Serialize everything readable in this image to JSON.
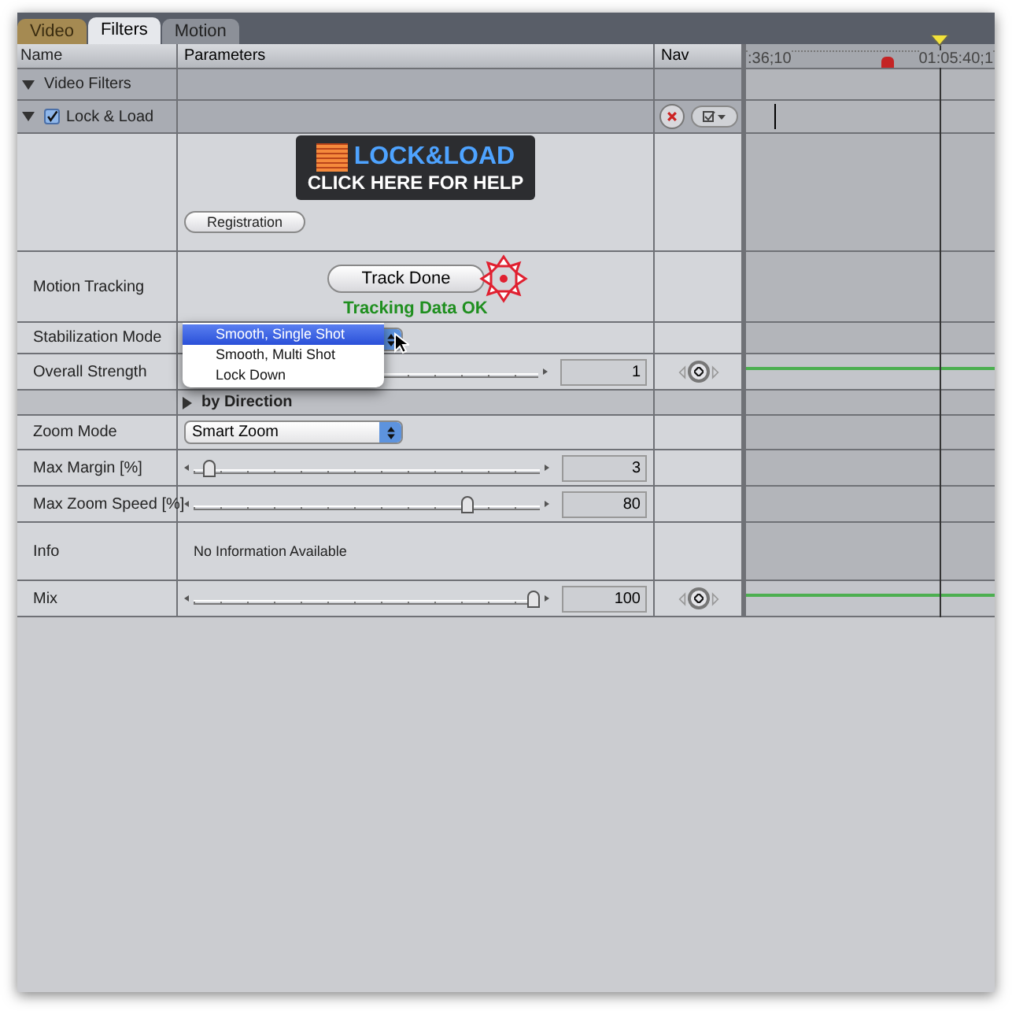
{
  "tabs": [
    {
      "label": "Video",
      "selected": false
    },
    {
      "label": "Filters",
      "selected": true
    },
    {
      "label": "Motion",
      "selected": false
    }
  ],
  "columns": [
    "Name",
    "Parameters",
    "Nav"
  ],
  "ruler_labels": [
    ":36;10",
    "01:05:40;1"
  ],
  "group": {
    "label": "Video Filters",
    "expanded": true
  },
  "filter": {
    "label": "Lock & Load",
    "expanded": true,
    "enabled": true
  },
  "rows": [
    {
      "kind": "banner",
      "banner_title": "LOCK&LOAD",
      "banner_subtitle": "CLICK HERE FOR HELP",
      "button": "Registration"
    },
    {
      "kind": "track",
      "label": "Motion Tracking",
      "button": "Track Done",
      "status": "Tracking Data OK"
    },
    {
      "kind": "menu",
      "label": "Stabilization Mode",
      "options": [
        {
          "label": "Smooth, Single Shot",
          "selected": true
        },
        {
          "label": "Smooth, Multi Shot",
          "selected": false
        },
        {
          "label": "Lock Down",
          "selected": false
        }
      ]
    },
    {
      "kind": "slider",
      "label": "Overall Strength",
      "value": "1",
      "keyframes": true
    },
    {
      "kind": "section",
      "label": "by Direction",
      "expanded": false
    },
    {
      "kind": "popup",
      "label": "Zoom Mode",
      "value": "Smart Zoom"
    },
    {
      "kind": "slider",
      "label": "Max Margin [%]",
      "level": 0.03,
      "value": "3",
      "keyframes": false
    },
    {
      "kind": "slider",
      "label": "Max Zoom Speed [%]",
      "level": 0.8,
      "value": "80",
      "keyframes": false
    },
    {
      "kind": "info",
      "label": "Info",
      "text": "No Information Available"
    },
    {
      "kind": "slider",
      "label": "Mix",
      "level": 1,
      "value": "100",
      "keyframes": true
    }
  ]
}
